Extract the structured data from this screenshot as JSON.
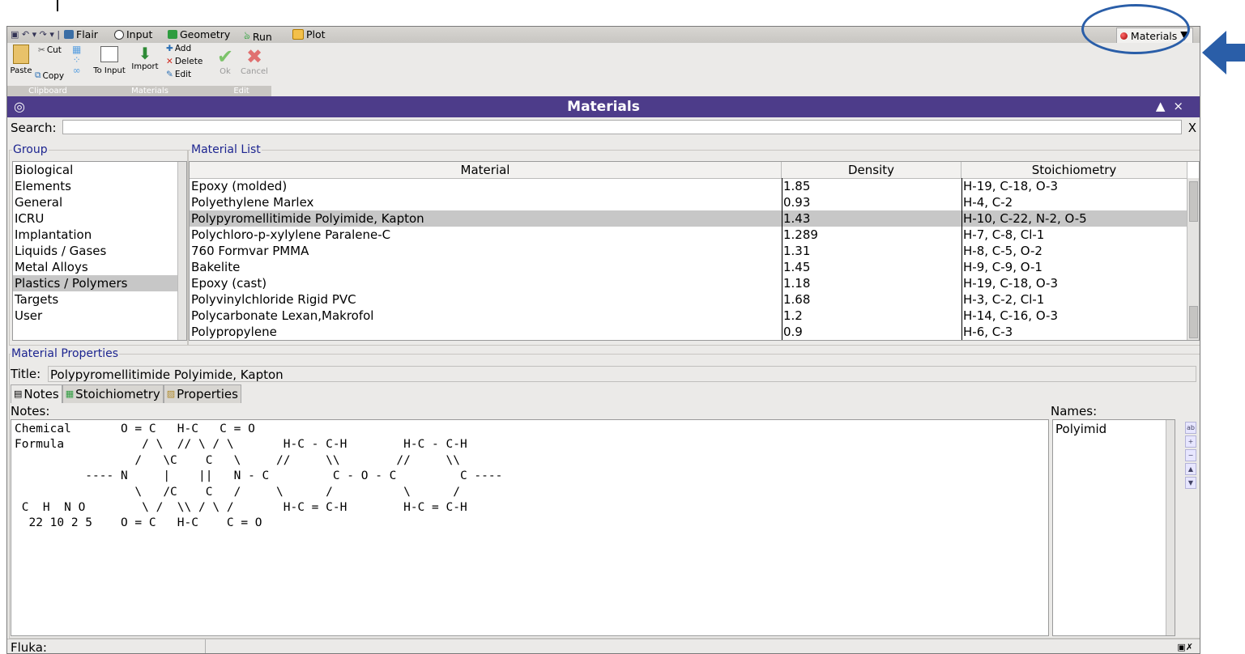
{
  "menubar": {
    "items": [
      {
        "label": "Flair",
        "icon": "flair-icon",
        "color": "#3a6ea5"
      },
      {
        "label": "Input",
        "icon": "input-icon",
        "color": "#2d2d2d"
      },
      {
        "label": "Geometry",
        "icon": "geometry-icon",
        "color": "#2e9c3f"
      },
      {
        "label": "Run",
        "icon": "run-icon",
        "color": "#3aa646"
      },
      {
        "label": "Plot",
        "icon": "plot-icon",
        "color": "#e09a10"
      }
    ],
    "current_page": "Materials"
  },
  "ribbon": {
    "clipboard": {
      "label": "Clipboard",
      "paste": "Paste",
      "cut": "Cut",
      "copy": "Copy"
    },
    "materials": {
      "label": "Materials",
      "to_input": "To Input",
      "import": "Import",
      "add": "Add",
      "delete": "Delete",
      "edit": "Edit"
    },
    "edit": {
      "label": "Edit",
      "ok": "Ok",
      "cancel": "Cancel"
    }
  },
  "header": {
    "title": "Materials",
    "left_icon": "◎",
    "collapse": "▲",
    "close": "×"
  },
  "search": {
    "label": "Search:",
    "value": "",
    "clear": "X"
  },
  "group": {
    "legend": "Group",
    "items": [
      "Biological",
      "Elements",
      "General",
      "ICRU",
      "Implantation",
      "Liquids / Gases",
      "Metal Alloys",
      "Plastics / Polymers",
      "Targets",
      "User"
    ],
    "selected": "Plastics / Polymers"
  },
  "material_list": {
    "legend": "Material List",
    "columns": [
      "Material",
      "Density",
      "Stoichiometry"
    ],
    "rows": [
      {
        "material": "Epoxy (molded)",
        "density": "1.85",
        "stoichiometry": "H-19, C-18, O-3"
      },
      {
        "material": "Polyethylene Marlex",
        "density": "0.93",
        "stoichiometry": "H-4, C-2"
      },
      {
        "material": "Polypyromellitimide Polyimide, Kapton",
        "density": "1.43",
        "stoichiometry": "H-10, C-22, N-2, O-5"
      },
      {
        "material": "Polychloro-p-xylylene Paralene-C",
        "density": "1.289",
        "stoichiometry": "H-7, C-8, Cl-1"
      },
      {
        "material": "760 Formvar PMMA",
        "density": "1.31",
        "stoichiometry": "H-8, C-5, O-2"
      },
      {
        "material": "Bakelite",
        "density": "1.45",
        "stoichiometry": "H-9, C-9, O-1"
      },
      {
        "material": "Epoxy (cast)",
        "density": "1.18",
        "stoichiometry": "H-19, C-18, O-3"
      },
      {
        "material": "Polyvinylchloride Rigid PVC",
        "density": "1.68",
        "stoichiometry": "H-3, C-2, Cl-1"
      },
      {
        "material": "Polycarbonate Lexan,Makrofol",
        "density": "1.2",
        "stoichiometry": "H-14, C-16, O-3"
      },
      {
        "material": "Polypropylene",
        "density": "0.9",
        "stoichiometry": "H-6, C-3"
      }
    ],
    "selected_index": 2
  },
  "properties": {
    "legend": "Material Properties",
    "title_label": "Title:",
    "title_value": "Polypyromellitimide Polyimide, Kapton",
    "tabs": [
      "Notes",
      "Stoichiometry",
      "Properties"
    ],
    "active_tab": "Notes",
    "notes_label": "Notes:",
    "names_label": "Names:",
    "notes_text": "Chemical       O = C   H-C   C = O\nFormula           / \\  // \\ / \\       H-C - C-H        H-C - C-H\n                 /   \\C    C   \\     //     \\\\        //     \\\\\n          ---- N     |    ||   N - C         C - O - C         C ----\n                 \\   /C    C   /     \\      /          \\      /\n C  H  N O        \\ /  \\\\ / \\ /       H-C = C-H        H-C = C-H\n  22 10 2 5    O = C   H-C    C = O",
    "names": [
      "Polyimid"
    ]
  },
  "status": {
    "label": "Fluka:",
    "value": ""
  },
  "colors": {
    "header_bg": "#4d3c8a",
    "legend_text": "#1d2590",
    "annotation": "#2a5ea8",
    "selection": "#c7c7c7"
  }
}
